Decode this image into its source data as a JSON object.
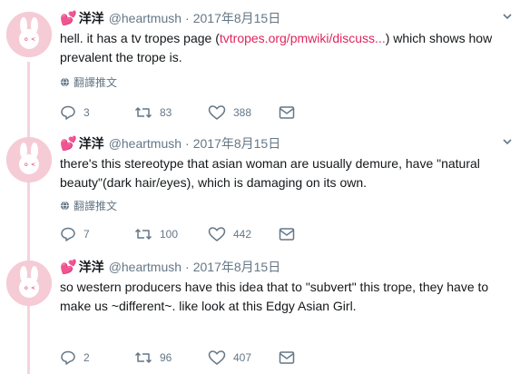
{
  "tweets": [
    {
      "display_name": "洋洋",
      "handle": "@heartmush",
      "separator": "·",
      "date": "2017年8月15日",
      "text_before": "hell. it has a tv tropes page (",
      "link": "tvtropes.org/pmwiki/discuss...",
      "text_after": ") which shows how prevalent the trope is.",
      "translate_label": "翻譯推文",
      "replies": "3",
      "retweets": "83",
      "likes": "388"
    },
    {
      "display_name": "洋洋",
      "handle": "@heartmush",
      "separator": "·",
      "date": "2017年8月15日",
      "text": "there's this stereotype that asian woman are usually demure, have \"natural beauty\"(dark hair/eyes), which is damaging on its own.",
      "translate_label": "翻譯推文",
      "replies": "7",
      "retweets": "100",
      "likes": "442"
    },
    {
      "display_name": "洋洋",
      "handle": "@heartmush",
      "separator": "·",
      "date": "2017年8月15日",
      "text": "so western producers have this idea that to \"subvert\" this trope, they have to make us ~different~. like look at this Edgy Asian Girl.",
      "replies": "2",
      "retweets": "96",
      "likes": "407"
    }
  ],
  "colors": {
    "accent": "#e0245e",
    "muted": "#657786",
    "avatar_bg": "#f5cbd6",
    "thread": "#f7d3dc"
  },
  "icons": [
    "heart-emoji-icon",
    "globe-icon",
    "reply-icon",
    "retweet-icon",
    "like-icon",
    "message-icon",
    "chevron-down-icon"
  ]
}
